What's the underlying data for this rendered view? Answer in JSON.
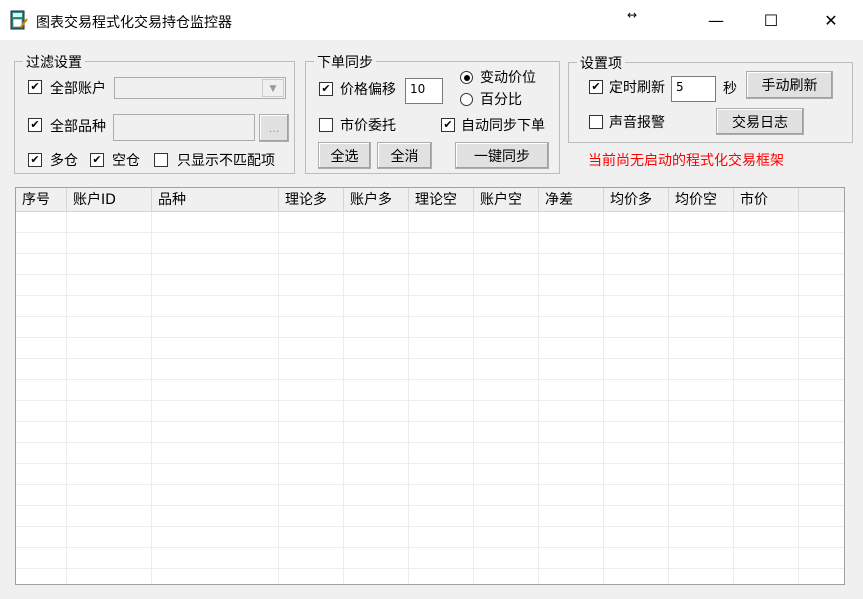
{
  "window": {
    "title": "图表交易程式化交易持仓监控器",
    "resize_glyph": "↔",
    "minimize": "—",
    "maximize": "☐",
    "close": "✕"
  },
  "filter": {
    "legend": "过滤设置",
    "all_accounts": "全部账户",
    "all_products": "全部品种",
    "browse": "...",
    "long": "多仓",
    "short": "空仓",
    "only_mismatch": "只显示不匹配项"
  },
  "order_sync": {
    "legend": "下单同步",
    "price_offset": "价格偏移",
    "offset_value": "10",
    "radio_tick": "变动价位",
    "radio_percent": "百分比",
    "market_order": "市价委托",
    "auto_sync": "自动同步下单",
    "select_all": "全选",
    "deselect_all": "全消",
    "one_click_sync": "一键同步"
  },
  "settings": {
    "legend": "设置项",
    "timed_refresh": "定时刷新",
    "refresh_value": "5",
    "seconds": "秒",
    "manual_refresh": "手动刷新",
    "sound_alarm": "声音报警",
    "trade_log": "交易日志"
  },
  "status": {
    "message": "当前尚无启动的程式化交易框架",
    "color": "#ff0000"
  },
  "table": {
    "columns": [
      "序号",
      "账户ID",
      "品种",
      "理论多",
      "账户多",
      "理论空",
      "账户空",
      "净差",
      "均价多",
      "均价空",
      "市价"
    ]
  }
}
